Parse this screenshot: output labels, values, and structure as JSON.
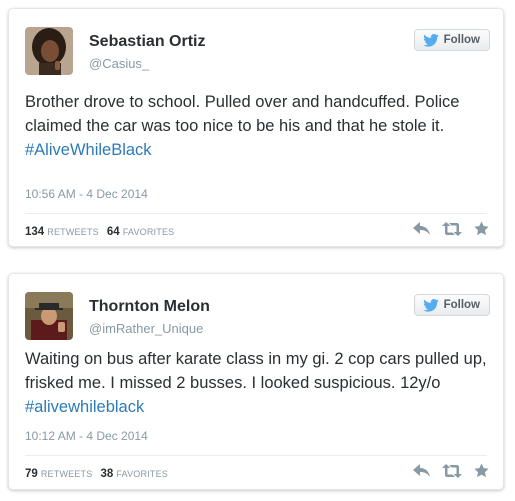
{
  "tweets": [
    {
      "name": "Sebastian Ortiz",
      "handle": "@Casius_",
      "follow_label": "Follow",
      "text": "Brother drove to school. Pulled over and handcuffed. Police claimed the car was too nice to be his and that he stole it.",
      "hashtag": "#AliveWhileBlack",
      "time": "10:56 AM - 4 Dec 2014",
      "retweets_count": "134",
      "retweets_label": "RETWEETS",
      "favorites_count": "64",
      "favorites_label": "FAVORITES"
    },
    {
      "name": "Thornton Melon",
      "handle": "@imRather_Unique",
      "follow_label": "Follow",
      "text": "Waiting on bus after karate class in my gi. 2 cop cars pulled up, frisked me. I missed 2 busses. I looked suspicious. 12y/o",
      "hashtag": "#alivewhileblack",
      "time": "10:12 AM - 4 Dec 2014",
      "retweets_count": "79",
      "retweets_label": "RETWEETS",
      "favorites_count": "38",
      "favorites_label": "FAVORITES"
    }
  ],
  "colors": {
    "link": "#2b7bb9",
    "twitter_blue": "#55acee",
    "muted": "#8899a6",
    "text": "#292f33"
  },
  "icons": [
    "twitter-bird-icon",
    "reply-icon",
    "retweet-icon",
    "favorite-star-icon"
  ]
}
